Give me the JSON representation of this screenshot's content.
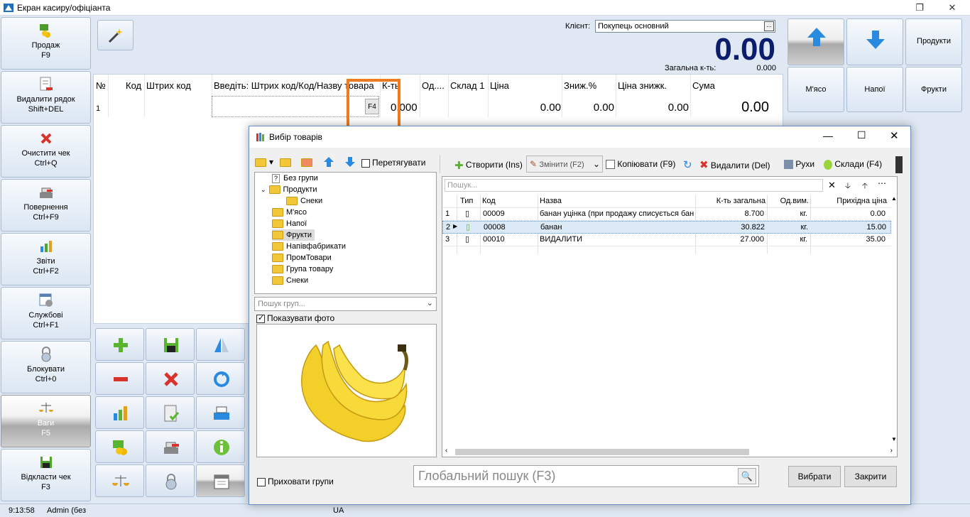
{
  "window": {
    "title": "Екран касиру/офіціанта"
  },
  "nav": [
    {
      "l1": "Продаж",
      "l2": "F9"
    },
    {
      "l1": "Видалити рядок",
      "l2": "Shift+DEL"
    },
    {
      "l1": "Очистити чек",
      "l2": "Ctrl+Q"
    },
    {
      "l1": "Повернення",
      "l2": "Ctrl+F9"
    },
    {
      "l1": "Звіти",
      "l2": "Ctrl+F2"
    },
    {
      "l1": "Службові",
      "l2": "Ctrl+F1"
    },
    {
      "l1": "Блокувати",
      "l2": "Ctrl+0"
    },
    {
      "l1": "Ваги",
      "l2": "F5"
    },
    {
      "l1": "Відкласти чек",
      "l2": "F3"
    }
  ],
  "client": {
    "label": "Клієнт:",
    "value": "Покупець основний"
  },
  "totals": {
    "amount": "0.00",
    "qty_label": "Загальна к-ть:",
    "qty_value": "0.000"
  },
  "receipt": {
    "headers": [
      "№",
      "Код",
      "Штрих код",
      "Введіть: Штрих код/Код/Назву товара",
      "К-ть",
      "Од....",
      "Склад 1",
      "Ціна",
      "Зниж.%",
      "Ціна знижк.",
      "Сума"
    ],
    "row": {
      "num": "1",
      "qty": "0.000",
      "price": "0.00",
      "disc": "0.00",
      "disc_price": "0.00",
      "sum": "0.00"
    },
    "f4": "F4"
  },
  "right": {
    "b1": "Продукти",
    "b2": "М'ясо",
    "b3": "Напої",
    "b4": "Фрукти"
  },
  "status": {
    "time": "9:13:58",
    "user": "Admin (без",
    "lang": "UA"
  },
  "dialog": {
    "title": "Вибір товарів",
    "drag": "Перетягувати",
    "toolbar": {
      "create": "Створити (Ins)",
      "edit": "Змінити (F2)",
      "copy": "Копіювати (F9)",
      "del": "Видалити (Del)",
      "moves": "Рухи",
      "stock": "Склади (F4)"
    },
    "tree": [
      "Без групи",
      "Продукти",
      "Снеки",
      "М'ясо",
      "Напої",
      "Фрукти",
      "Напівфабрикати",
      "ПромТовари",
      "Група товару",
      "Снеки"
    ],
    "group_search": "Пошук груп...",
    "show_photo": "Показувати фото",
    "search_placeholder": "Пошук...",
    "columns": [
      "Тип",
      "Код",
      "Назва",
      "К-ть загальна",
      "Од.вим.",
      "Прихідна ціна"
    ],
    "rows": [
      {
        "n": "1",
        "code": "00009",
        "name": "банан уцінка (при продажу списується бан",
        "qty": "8.700",
        "unit": "кг.",
        "price": "0.00"
      },
      {
        "n": "2",
        "code": "00008",
        "name": "банан",
        "qty": "30.822",
        "unit": "кг.",
        "price": "15.00"
      },
      {
        "n": "3",
        "code": "00010",
        "name": "ВИДАЛИТИ",
        "qty": "27.000",
        "unit": "кг.",
        "price": "35.00"
      }
    ],
    "hide_groups": "Приховати групи",
    "global_search": "Глобальний пошук (F3)",
    "select": "Вибрати",
    "close": "Закрити"
  }
}
